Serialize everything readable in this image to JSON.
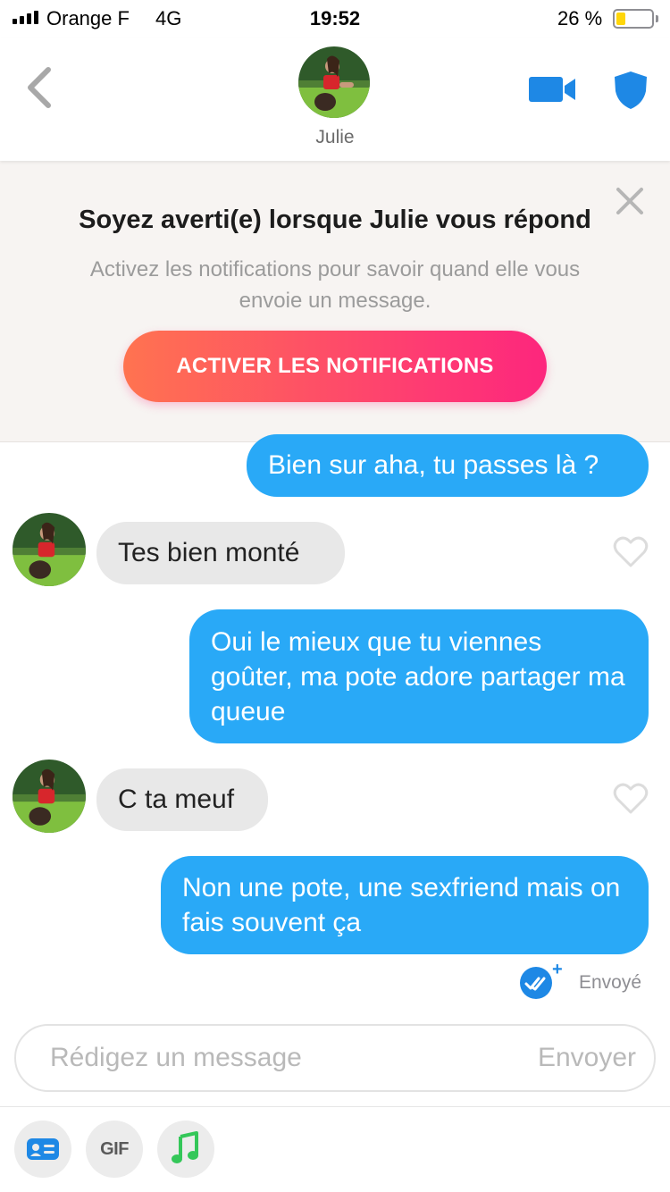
{
  "status_bar": {
    "carrier": "Orange F",
    "network": "4G",
    "time": "19:52",
    "battery_percent": "26 %",
    "battery_level": 0.26
  },
  "header": {
    "contact_name": "Julie",
    "icons": [
      "back-chevron-icon",
      "video-camera-icon",
      "shield-icon"
    ]
  },
  "notification_banner": {
    "title": "Soyez averti(e) lorsque Julie vous répond",
    "text": "Activez les notifications pour savoir quand elle vous envoie un message.",
    "button_label": "ACTIVER LES NOTIFICATIONS",
    "close_icon": "close-icon"
  },
  "messages": [
    {
      "direction": "sent",
      "text": "Bien sur aha, tu passes là ?"
    },
    {
      "direction": "received",
      "text": "Tes bien monté"
    },
    {
      "direction": "sent",
      "text": "Oui le mieux que tu viennes goûter, ma pote adore partager ma queue"
    },
    {
      "direction": "received",
      "text": "C ta meuf"
    },
    {
      "direction": "sent",
      "text": "Non une pote, une sexfriend mais on fais souvent ça"
    }
  ],
  "read_receipt": {
    "status": "Envoyé",
    "plus": "+",
    "icon": "double-check-icon"
  },
  "composer": {
    "placeholder": "Rédigez un message",
    "send_label": "Envoyer"
  },
  "toolbar": {
    "gif_label": "GIF",
    "icons": [
      "contact-card-icon",
      "gif-icon",
      "music-note-icon"
    ]
  },
  "colors": {
    "sent_bubble": "#29a9f7",
    "received_bubble": "#e8e8e8",
    "accent_gradient_start": "#ff7350",
    "accent_gradient_end": "#fd267d",
    "header_icons": "#1e88e5",
    "music_icon": "#34c759"
  }
}
